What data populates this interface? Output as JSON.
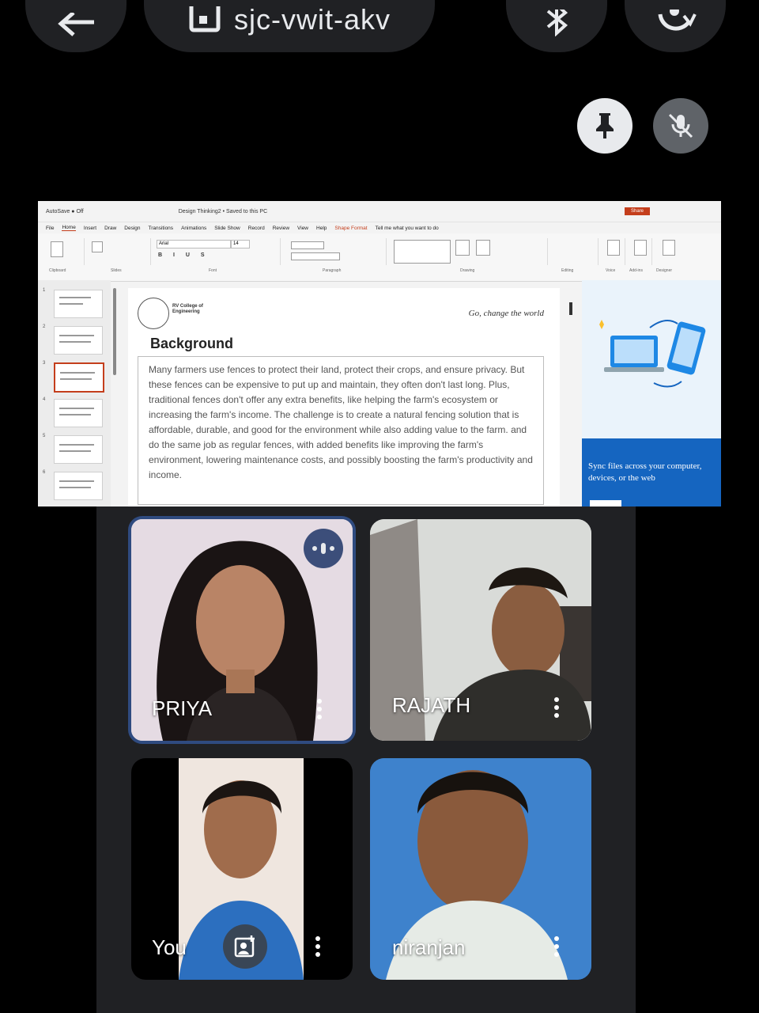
{
  "top_bar": {
    "meeting_code": "sjc-vwit-akv",
    "icons": [
      "back-arrow-icon",
      "meeting-info-icon",
      "bluetooth-icon",
      "switch-camera-icon"
    ]
  },
  "presentation": {
    "pin_icon": "pin-icon",
    "mute_icon": "mic-off-icon",
    "ppt": {
      "window_title": "Design Thinking2 • Saved to this PC",
      "share_label": "Share",
      "menu": [
        "File",
        "Home",
        "Insert",
        "Draw",
        "Design",
        "Transitions",
        "Animations",
        "Slide Show",
        "Record",
        "Review",
        "View",
        "Help",
        "Shape Format"
      ],
      "tell_me": "Tell me what you want to do",
      "ribbon_groups": [
        "Clipboard",
        "Slides",
        "Font",
        "Paragraph",
        "Drawing",
        "Editing",
        "Voice",
        "Add-ins",
        "Designer"
      ],
      "font_name": "Arial",
      "font_size": "14",
      "slide_numbers": [
        "1",
        "2",
        "3",
        "4",
        "5",
        "6"
      ],
      "slide": {
        "college": "RV College of Engineering",
        "motto": "Go, change the world",
        "heading": "Background",
        "body": "Many farmers use fences to protect their land, protect their crops, and ensure privacy. But these fences can be expensive to put up and maintain, they often don't last long. Plus, traditional fences don't offer any extra benefits, like helping the farm's ecosystem or increasing the farm's income. The challenge is to create a natural fencing solution that is affordable, durable, and good for the environment while also adding value to the farm. and do the same job as regular fences, with added benefits like improving the farm's environment, lowering maintenance costs, and possibly boosting the farm's productivity and income."
      },
      "onedrive_pane": {
        "promo": "Sync files across your computer, devices, or the web"
      }
    }
  },
  "participants": [
    {
      "name": "PRIYA",
      "speaking": true
    },
    {
      "name": "RAJATH",
      "speaking": false
    },
    {
      "name": "You",
      "speaking": false
    },
    {
      "name": "niranjan",
      "speaking": false
    }
  ],
  "colors": {
    "background": "#000000",
    "surface": "#202124",
    "active_border": "#2f4b80",
    "ppt_accent": "#c43e1c"
  }
}
